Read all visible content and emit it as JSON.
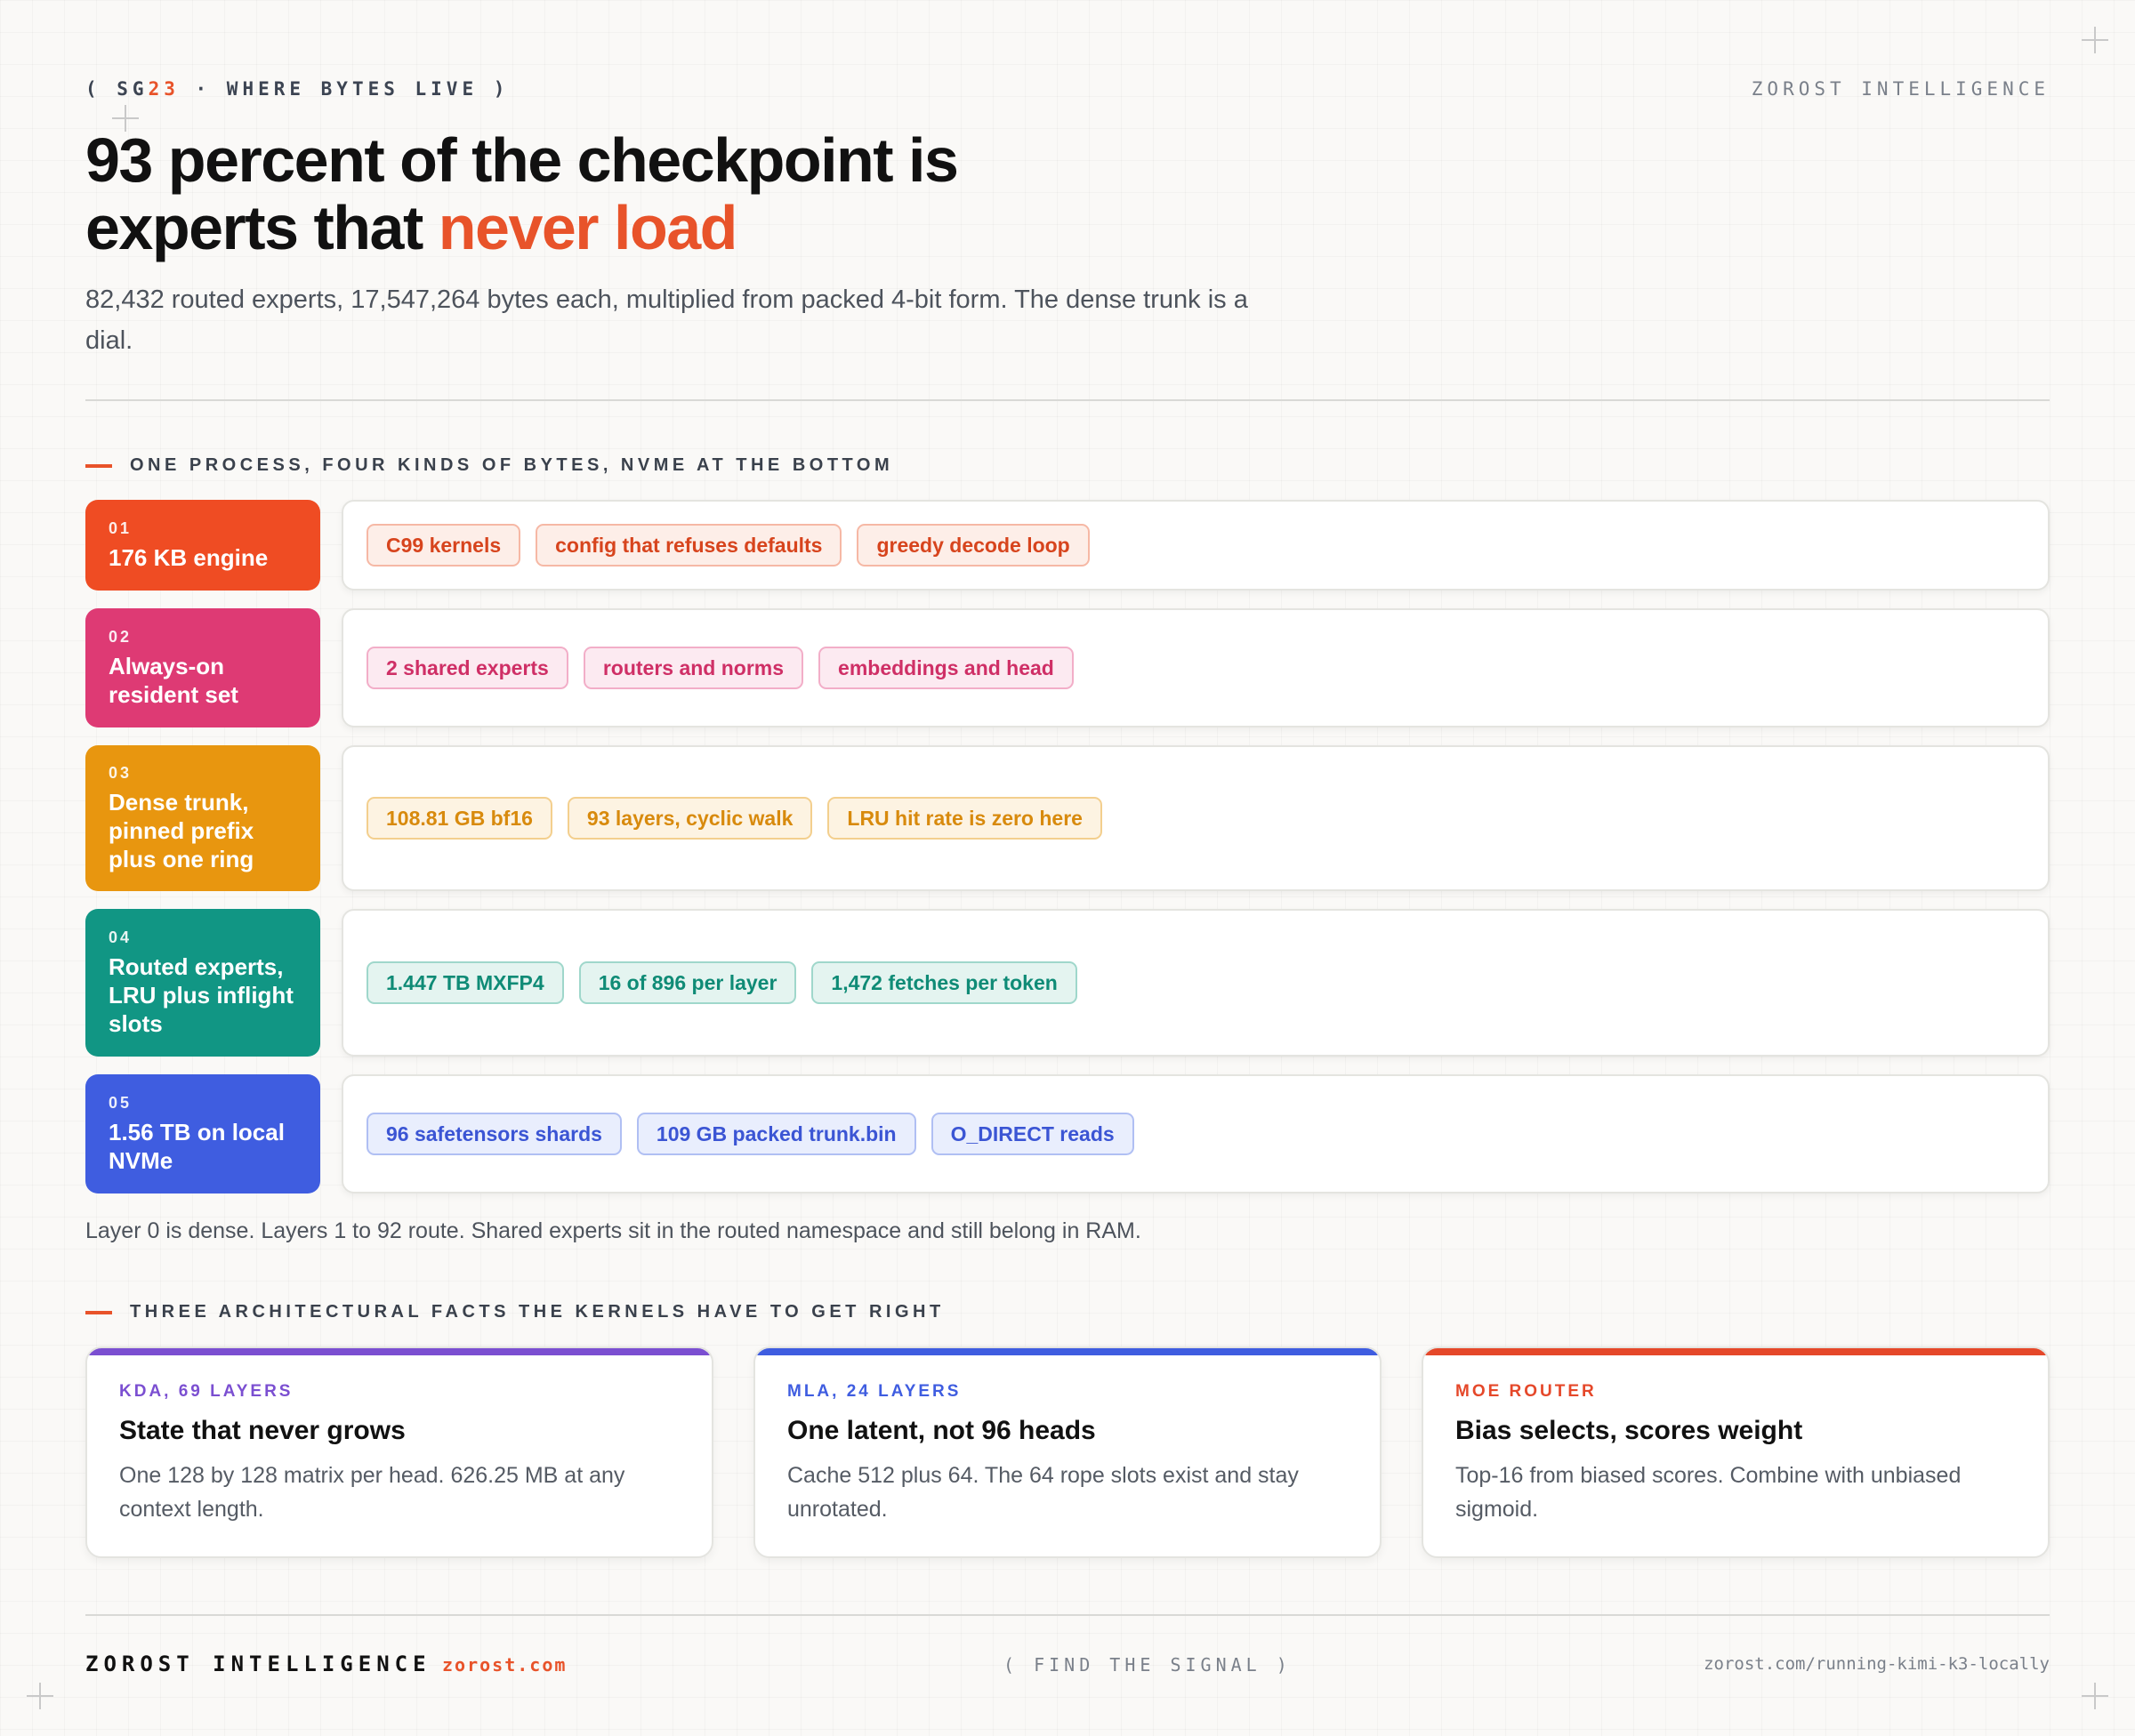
{
  "header": {
    "kicker_open": "( SG",
    "kicker_accent": "23",
    "kicker_close": " · WHERE BYTES LIVE )",
    "brand": "ZOROST INTELLIGENCE"
  },
  "title": {
    "line1": "93 percent of the checkpoint is",
    "line2_plain": "experts that ",
    "line2_highlight": "never load"
  },
  "subtitle": "82,432 routed experts, 17,547,264 bytes each, multiplied from packed 4-bit form. The dense trunk is a dial.",
  "section1": {
    "label": "ONE PROCESS, FOUR KINDS OF BYTES, NVME AT THE BOTTOM",
    "rows": [
      {
        "num": "01",
        "title": "176 KB engine",
        "color": "#ef4c23",
        "tags": [
          "C99 kernels",
          "config that refuses defaults",
          "greedy decode loop"
        ]
      },
      {
        "num": "02",
        "title": "Always-on resident set",
        "color": "#de3a74",
        "tags": [
          "2 shared experts",
          "routers and norms",
          "embeddings and head"
        ]
      },
      {
        "num": "03",
        "title": "Dense trunk, pinned prefix plus one ring",
        "color": "#e8960f",
        "tags": [
          "108.81 GB bf16",
          "93 layers, cyclic walk",
          "LRU hit rate is zero here"
        ]
      },
      {
        "num": "04",
        "title": "Routed experts, LRU plus inflight slots",
        "color": "#119684",
        "tags": [
          "1.447 TB MXFP4",
          "16 of 896 per layer",
          "1,472 fetches per token"
        ]
      },
      {
        "num": "05",
        "title": "1.56 TB on local NVMe",
        "color": "#3f5de0",
        "tags": [
          "96 safetensors shards",
          "109 GB packed trunk.bin",
          "O_DIRECT reads"
        ]
      }
    ],
    "note": "Layer 0 is dense. Layers 1 to 92 route. Shared experts sit in the routed namespace and still belong in RAM."
  },
  "section2": {
    "label": "THREE ARCHITECTURAL FACTS THE KERNELS HAVE TO GET RIGHT",
    "cards": [
      {
        "kicker": "KDA, 69 LAYERS",
        "title": "State that never grows",
        "text": "One 128 by 128 matrix per head. 626.25 MB at any context length.",
        "color": "#7b4fd1"
      },
      {
        "kicker": "MLA, 24 LAYERS",
        "title": "One latent, not 96 heads",
        "text": "Cache 512 plus 64. The 64 rope slots exist and stay unrotated.",
        "color": "#3f5de0"
      },
      {
        "kicker": "MOE ROUTER",
        "title": "Bias selects, scores weight",
        "text": "Top-16 from biased scores. Combine with unbiased sigmoid.",
        "color": "#e5482a"
      }
    ]
  },
  "footer": {
    "brand": "ZOROST INTELLIGENCE",
    "site": "zorost.com",
    "tagline": "( FIND THE SIGNAL )",
    "url": "zorost.com/running-kimi-k3-locally"
  }
}
